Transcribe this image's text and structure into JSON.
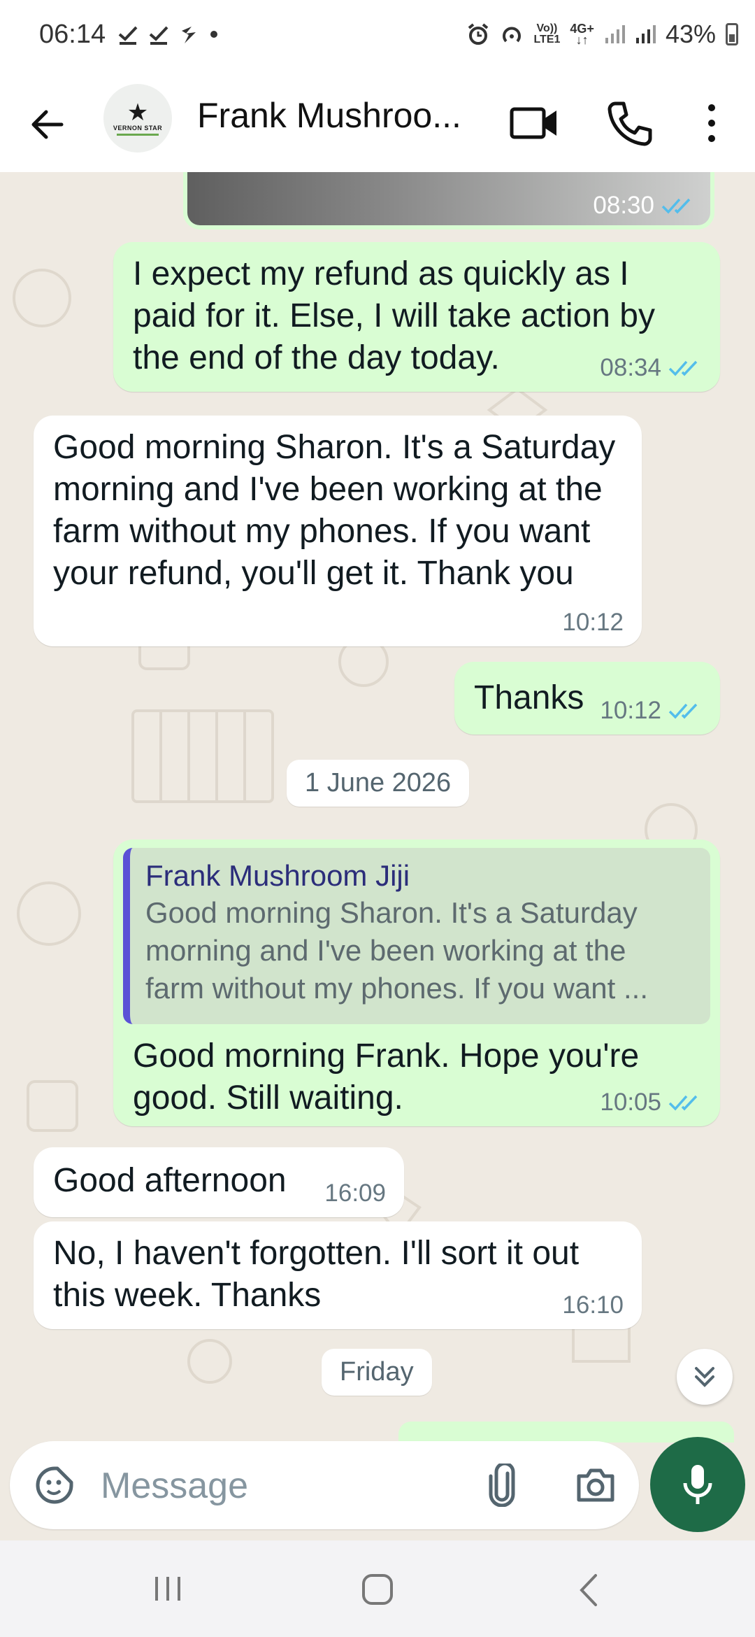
{
  "status_bar": {
    "time": "06:14",
    "network_top": "Vo))",
    "network_bottom": "LTE1",
    "network_type": "4G+",
    "battery": "43%"
  },
  "header": {
    "contact_name": "Frank Mushroo...",
    "avatar_brand": "VERNON STAR"
  },
  "colors": {
    "outgoing_bubble": "#d9fdd3",
    "incoming_bubble": "#ffffff",
    "read_tick": "#53bdeb",
    "chat_background": "#efeae2",
    "mic_button": "#1e6b47",
    "quote_bar": "#5b52d6"
  },
  "messages": [
    {
      "id": "m0",
      "direction": "out",
      "type": "image",
      "time": "08:30",
      "status": "read"
    },
    {
      "id": "m1",
      "direction": "out",
      "text": "I expect my refund as quickly as I paid for it. Else, I will take action by the end of the day today.",
      "time": "08:34",
      "status": "read"
    },
    {
      "id": "m2",
      "direction": "in",
      "text": "Good morning Sharon. It's a Saturday morning and I've been working at the farm without my phones. If you want your refund, you'll get it. Thank you",
      "time": "10:12"
    },
    {
      "id": "m3",
      "direction": "out",
      "text": "Thanks",
      "time": "10:12",
      "status": "read"
    },
    {
      "id": "m4",
      "direction": "out",
      "quote_author": "Frank Mushroom Jiji",
      "quote_lines": [
        "Good morning Sharon. It's a Saturday",
        "morning and I've been working at the",
        "farm without my phones. If you want ..."
      ],
      "text": "Good morning Frank. Hope you're good. Still waiting.",
      "time": "10:05",
      "status": "read"
    },
    {
      "id": "m5",
      "direction": "in",
      "text": "Good afternoon",
      "time": "16:09"
    },
    {
      "id": "m6",
      "direction": "in",
      "text": "No, I haven't forgotten. I'll sort it out this week. Thanks",
      "time": "16:10"
    }
  ],
  "date_separators": [
    "1 June 2026",
    "Friday"
  ],
  "input": {
    "placeholder": "Message"
  },
  "icons": {
    "back": "arrow-left-icon",
    "video": "video-camera-icon",
    "call": "phone-icon",
    "menu": "more-vertical-icon",
    "emoji": "sticker-icon",
    "attach": "paperclip-icon",
    "camera": "camera-icon",
    "mic": "microphone-icon",
    "scroll": "double-chevron-down-icon"
  }
}
